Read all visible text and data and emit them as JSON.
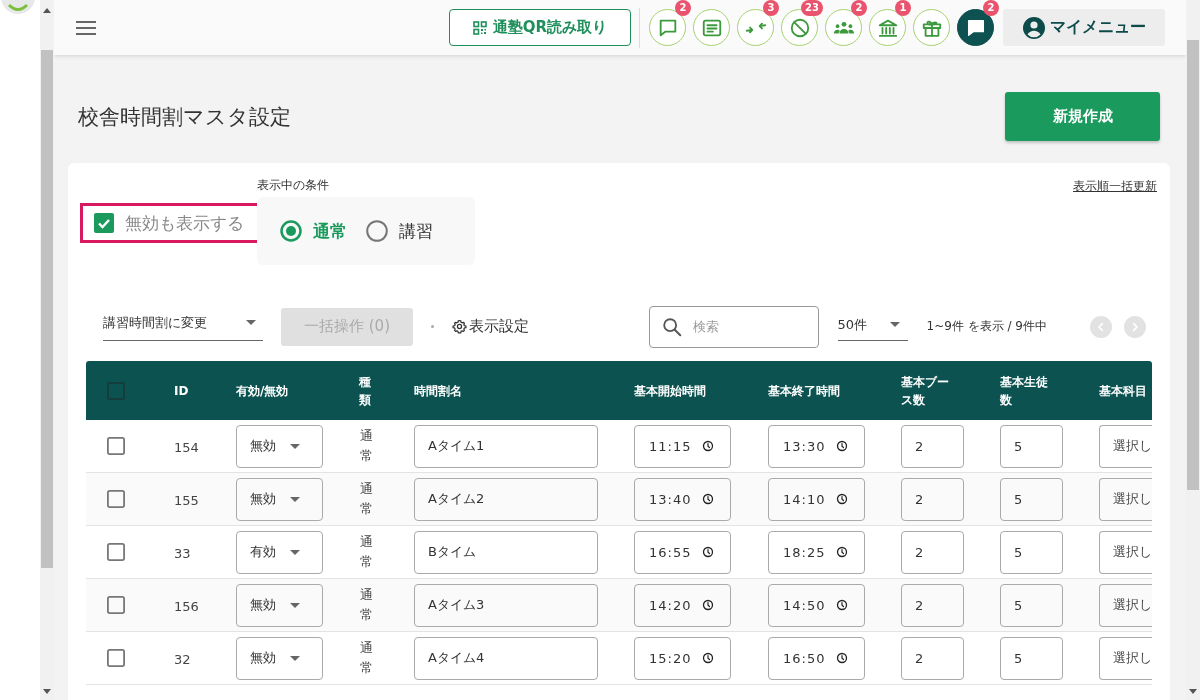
{
  "top_bar": {
    "qr_button": "通塾QR読み取り",
    "icon_buttons": [
      {
        "badge": "2",
        "selected": false
      },
      {
        "selected": false
      },
      {
        "badge": "3",
        "selected": false
      },
      {
        "badge": "23",
        "selected": false
      },
      {
        "badge": "2",
        "selected": false
      },
      {
        "badge": "1",
        "selected": false
      },
      {
        "selected": false
      },
      {
        "badge": "2",
        "selected": true
      }
    ],
    "my_menu": "マイメニュー"
  },
  "page": {
    "title": "校舎時間割マスタ設定",
    "new_button": "新規作成"
  },
  "filters": {
    "condition_label": "表示中の条件",
    "show_inactive": {
      "label": "無効も表示する",
      "checked": true,
      "highlighted": true
    },
    "mode_options": [
      {
        "label": "通常",
        "selected": true
      },
      {
        "label": "講習",
        "selected": false
      }
    ],
    "reorder_link": "表示順一括更新"
  },
  "toolbar": {
    "timetable_select": "講習時間割に変更",
    "bulk_button": {
      "label": "一括操作 (0)",
      "disabled": true
    },
    "display_settings": "表示設定",
    "search": {
      "placeholder": "検索"
    },
    "page_size": "50件",
    "range": "1~9件 を表示 / 9件中",
    "pager": {
      "prev": {
        "disabled": true
      },
      "next": {
        "disabled": true
      }
    }
  },
  "table": {
    "select_all": {
      "checked": false
    },
    "columns": [
      "ID",
      "有効/無効",
      "種類",
      "時間割名",
      "基本開始時間",
      "基本終了時間",
      "基本ブース数",
      "基本生徒数",
      "基本科目"
    ],
    "rows": [
      {
        "checked": false,
        "id": "154",
        "status": "無効",
        "type": "通常",
        "name": "Aタイム1",
        "start": "11:15",
        "end": "13:30",
        "booths": "2",
        "students": "5",
        "subject": "選択し"
      },
      {
        "checked": false,
        "id": "155",
        "status": "無効",
        "type": "通常",
        "name": "Aタイム2",
        "start": "13:40",
        "end": "14:10",
        "booths": "2",
        "students": "5",
        "subject": "選択し"
      },
      {
        "checked": false,
        "id": "33",
        "status": "有効",
        "type": "通常",
        "name": "Bタイム",
        "start": "16:55",
        "end": "18:25",
        "booths": "2",
        "students": "5",
        "subject": "選択し"
      },
      {
        "checked": false,
        "id": "156",
        "status": "無効",
        "type": "通常",
        "name": "Aタイム3",
        "start": "14:20",
        "end": "14:50",
        "booths": "2",
        "students": "5",
        "subject": "選択し"
      },
      {
        "checked": false,
        "id": "32",
        "status": "無効",
        "type": "通常",
        "name": "Aタイム4",
        "start": "15:20",
        "end": "16:50",
        "booths": "2",
        "students": "5",
        "subject": "選択し"
      }
    ]
  }
}
